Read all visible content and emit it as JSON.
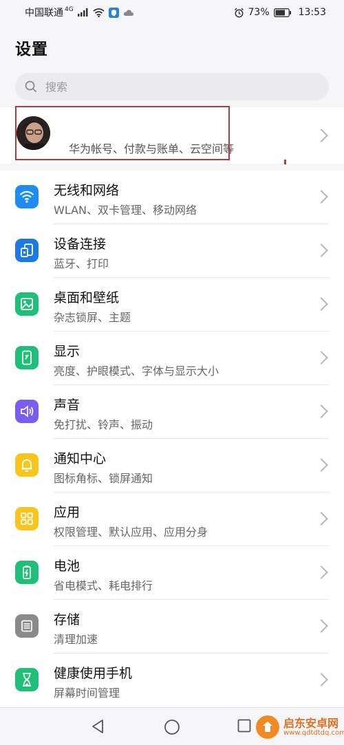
{
  "status_bar": {
    "carrier": "中国联通",
    "network": "4G",
    "battery": "73%",
    "time": "13:53"
  },
  "page": {
    "title": "设置"
  },
  "search": {
    "placeholder": "搜索"
  },
  "account": {
    "subtitle": "华为帐号、付款与账单、云空间等"
  },
  "settings": [
    {
      "title": "无线和网络",
      "subtitle": "WLAN、双卡管理、移动网络",
      "icon": "wifi-icon",
      "color": "#1e8cf0"
    },
    {
      "title": "设备连接",
      "subtitle": "蓝牙、打印",
      "icon": "device-connect-icon",
      "color": "#1e7ae0"
    },
    {
      "title": "桌面和壁纸",
      "subtitle": "杂志锁屏、主题",
      "icon": "wallpaper-icon",
      "color": "#1fbf78"
    },
    {
      "title": "显示",
      "subtitle": "亮度、护眼模式、字体与显示大小",
      "icon": "display-icon",
      "color": "#1fbf78"
    },
    {
      "title": "声音",
      "subtitle": "免打扰、铃声、振动",
      "icon": "sound-icon",
      "color": "#7a5cf0"
    },
    {
      "title": "通知中心",
      "subtitle": "图标角标、锁屏通知",
      "icon": "bell-icon",
      "color": "#f7c51e"
    },
    {
      "title": "应用",
      "subtitle": "权限管理、默认应用、应用分身",
      "icon": "apps-icon",
      "color": "#f7c51e"
    },
    {
      "title": "电池",
      "subtitle": "省电模式、耗电排行",
      "icon": "battery-icon",
      "color": "#1fbf78"
    },
    {
      "title": "存储",
      "subtitle": "清理加速",
      "icon": "storage-icon",
      "color": "#8a8a8a"
    },
    {
      "title": "健康使用手机",
      "subtitle": "屏幕时间管理",
      "icon": "hourglass-icon",
      "color": "#1fbf78"
    }
  ],
  "watermark": {
    "title": "启东安卓网",
    "url": "www.qdtdtdq.com"
  }
}
